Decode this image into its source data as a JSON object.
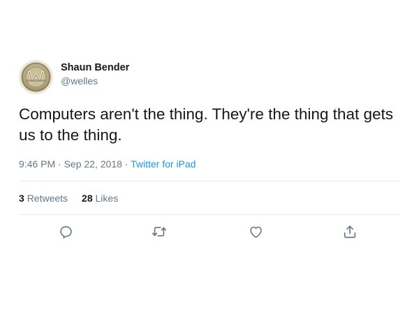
{
  "tweet": {
    "author": {
      "name": "Shaun Bender",
      "handle": "@welles",
      "avatar_icon": "westworld-logo-icon"
    },
    "text": "Computers aren't the thing. They're the thing that gets us to the thing.",
    "time": "9:46 PM",
    "date": "Sep 22, 2018",
    "separator": "·",
    "source": "Twitter for iPad",
    "stats": {
      "retweets_count": "3",
      "retweets_label": "Retweets",
      "likes_count": "28",
      "likes_label": "Likes"
    },
    "actions": [
      "reply-icon",
      "retweet-icon",
      "like-icon",
      "share-icon"
    ]
  },
  "colors": {
    "text": "#14171a",
    "secondary": "#657786",
    "link": "#1b95e0",
    "divider": "#e6ecf0",
    "action_icon": "#657786"
  }
}
